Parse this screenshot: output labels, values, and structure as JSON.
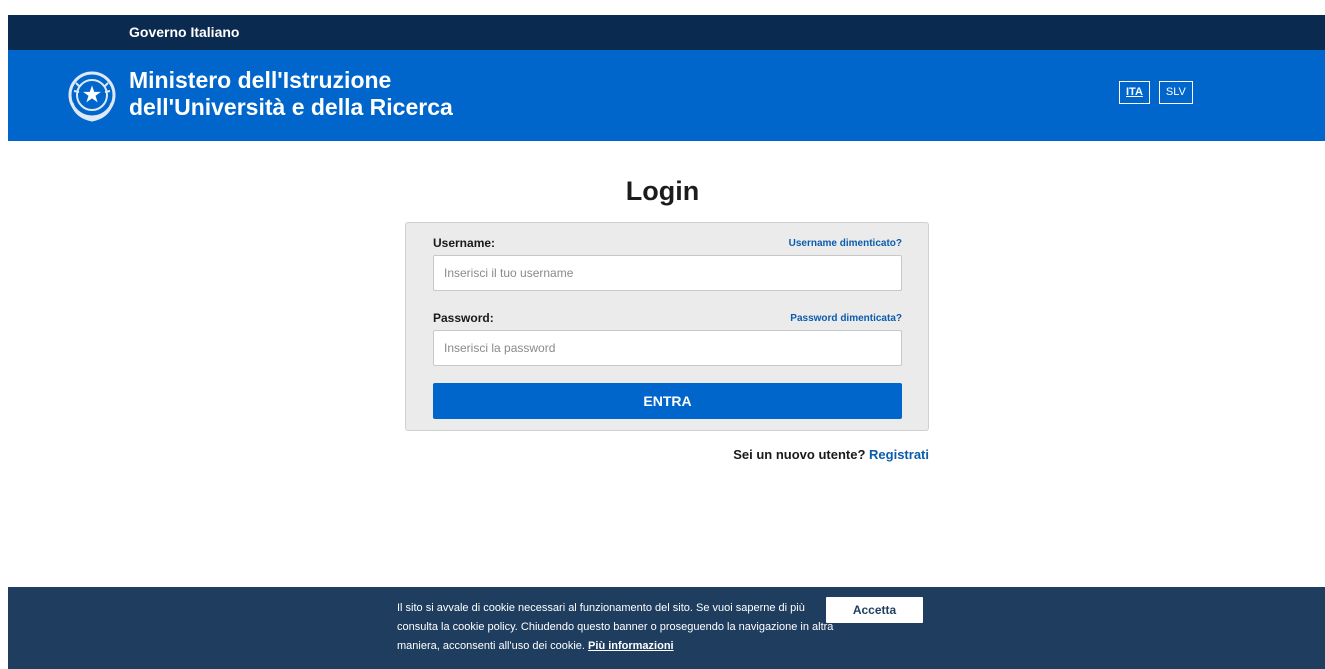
{
  "header": {
    "gov_label": "Governo Italiano",
    "ministry_line1": "Ministero dell'Istruzione",
    "ministry_line2": "dell'Università e della Ricerca",
    "languages": [
      {
        "label": "ITA",
        "active": true
      },
      {
        "label": "SLV",
        "active": false
      }
    ]
  },
  "login": {
    "title": "Login",
    "username_label": "Username:",
    "username_forgot": "Username dimenticato?",
    "username_placeholder": "Inserisci il tuo username",
    "username_value": "",
    "password_label": "Password:",
    "password_forgot": "Password dimenticata?",
    "password_placeholder": "Inserisci la password",
    "password_value": "",
    "submit_label": "ENTRA",
    "register_prompt": "Sei un nuovo utente?",
    "register_link": "Registrati"
  },
  "cookie": {
    "text": "Il sito si avvale di cookie necessari al funzionamento del sito. Se vuoi saperne di più consulta la cookie policy. Chiudendo questo banner o proseguendo la navigazione in altra maniera, acconsenti all'uso dei cookie.",
    "more_link": "Più informazioni",
    "accept_label": "Accetta"
  },
  "colors": {
    "gov_bar": "#0b2a4f",
    "brand": "#0066cc",
    "link": "#0b5cad",
    "cookie_bg": "#1f3e5f"
  },
  "icons": {
    "emblem": "italian-republic-emblem-icon"
  }
}
